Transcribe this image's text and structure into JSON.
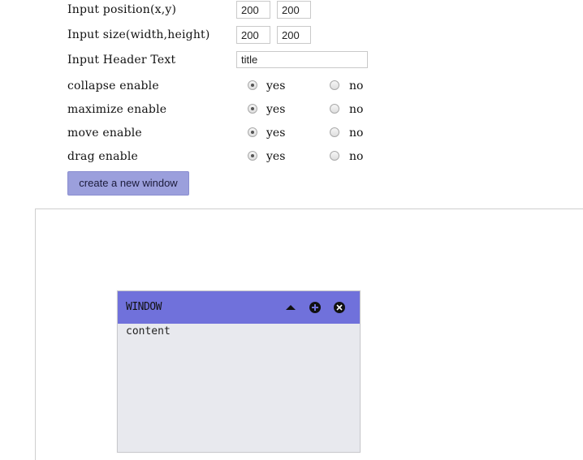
{
  "form": {
    "position": {
      "label": "Input position(x,y)",
      "x": "200",
      "y": "200"
    },
    "size": {
      "label": "Input size(width,height)",
      "width": "200",
      "height": "200"
    },
    "header_text": {
      "label": "Input Header Text",
      "value": "title"
    },
    "options": [
      {
        "label": "collapse enable",
        "yes": "yes",
        "no": "no",
        "selected": "yes"
      },
      {
        "label": "maximize enable",
        "yes": "yes",
        "no": "no",
        "selected": "yes"
      },
      {
        "label": "move enable",
        "yes": "yes",
        "no": "no",
        "selected": "yes"
      },
      {
        "label": "drag enable",
        "yes": "yes",
        "no": "no",
        "selected": "yes"
      }
    ],
    "create_button": "create a new window"
  },
  "window": {
    "title": "WINDOW",
    "content": "content",
    "header_color": "#7071db",
    "buttons": [
      "collapse-icon",
      "maximize-icon",
      "close-icon"
    ]
  },
  "colors": {
    "button_bg": "#9b9fdc",
    "window_body": "#e8e9ee"
  }
}
